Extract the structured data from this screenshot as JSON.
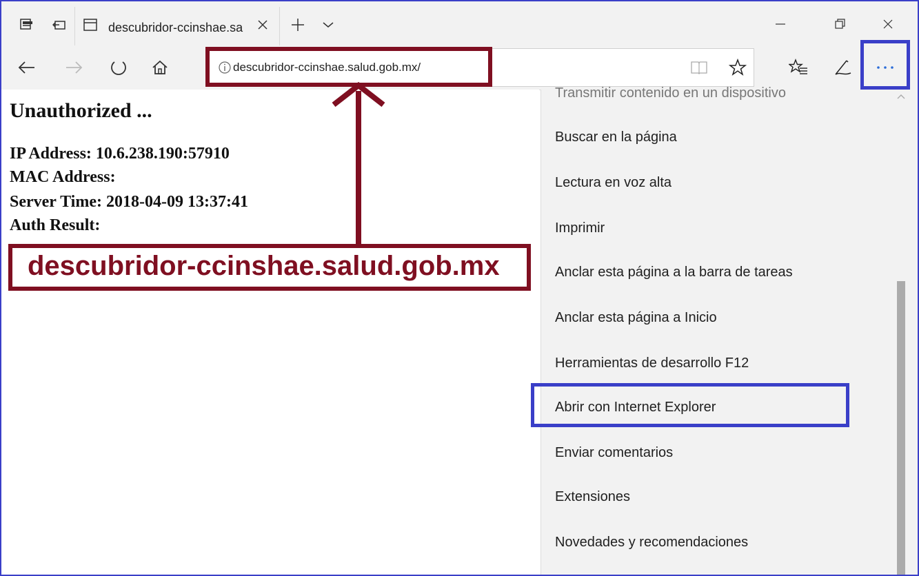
{
  "browser": {
    "tab_title": "descubridor-ccinshae.sa",
    "address_url": "descubridor-ccinshae.salud.gob.mx/",
    "icons": [
      "tabs-aside-icon",
      "back-tabs-icon",
      "page-icon",
      "close-tab-icon",
      "new-tab-icon",
      "chevron-down-icon",
      "minimize-icon",
      "restore-icon",
      "close-window-icon",
      "back-icon",
      "forward-icon",
      "refresh-icon",
      "home-icon",
      "info-icon",
      "reading-view-icon",
      "favorite-star-icon",
      "favorites-hub-icon",
      "pen-icon",
      "more-icon"
    ]
  },
  "page": {
    "heading": "Unauthorized ...",
    "lines": [
      "IP Address: 10.6.238.190:57910",
      "MAC Address:",
      "Server Time: 2018-04-09 13:37:41",
      "Auth Result:"
    ]
  },
  "annotation": {
    "domain_label": "descubridor-ccinshae.salud.gob.mx",
    "highlight_color_red": "#7f0f21",
    "highlight_color_blue": "#3a3fc8"
  },
  "menu": {
    "cut_item": "Transmitir contenido en un dispositivo",
    "items": [
      "Buscar en la página",
      "Lectura en voz alta",
      "Imprimir",
      "Anclar esta página a la barra de tareas",
      "Anclar esta página a Inicio",
      "Herramientas de desarrollo F12",
      "Abrir con Internet Explorer",
      "Enviar comentarios",
      "Extensiones",
      "Novedades y recomendaciones"
    ]
  }
}
